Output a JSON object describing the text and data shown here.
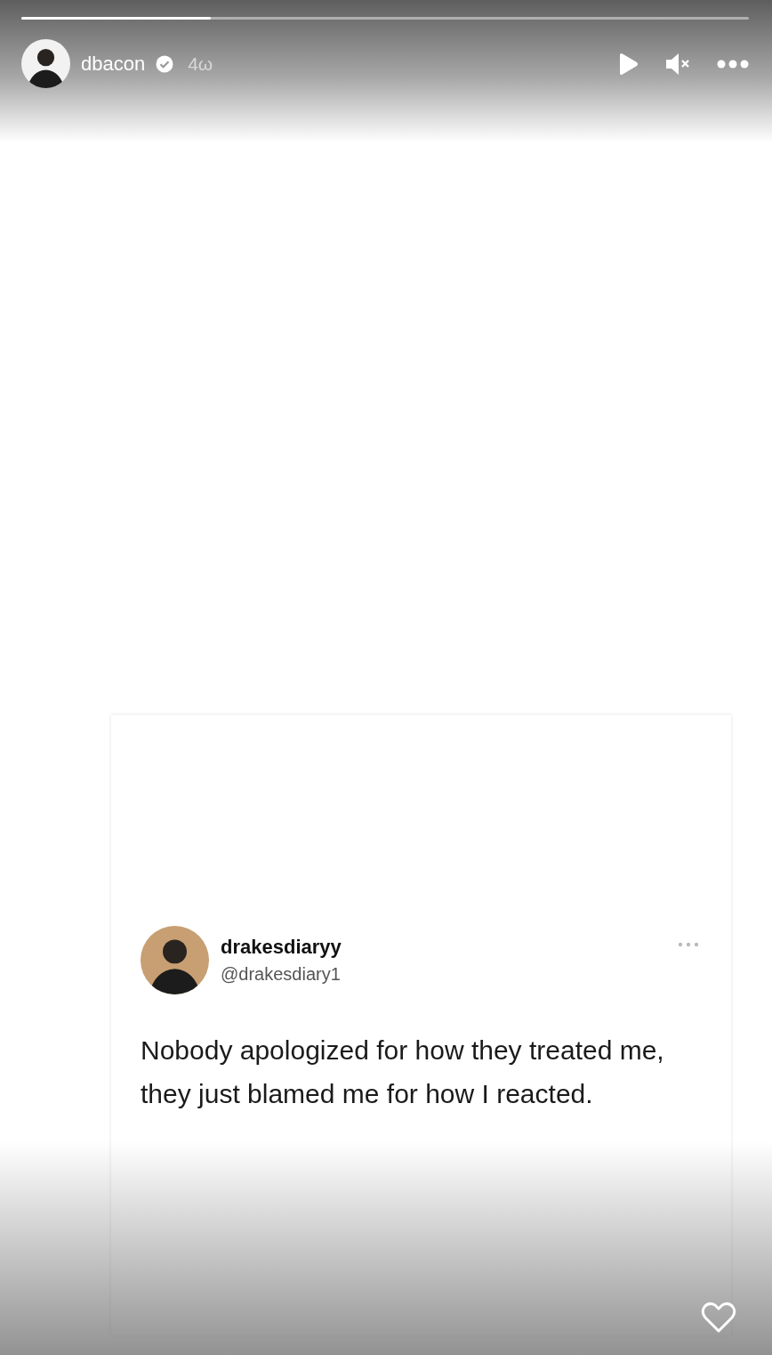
{
  "story": {
    "progress": {
      "level": 0.26
    },
    "author": {
      "username": "dbacon",
      "verified": true,
      "time": "4ω"
    },
    "post": {
      "display_name": "drakesdiaryy",
      "handle": "@drakesdiary1",
      "text": "Nobody apologized for how they treated me, they just blamed me for how I reacted."
    },
    "liked": false
  }
}
